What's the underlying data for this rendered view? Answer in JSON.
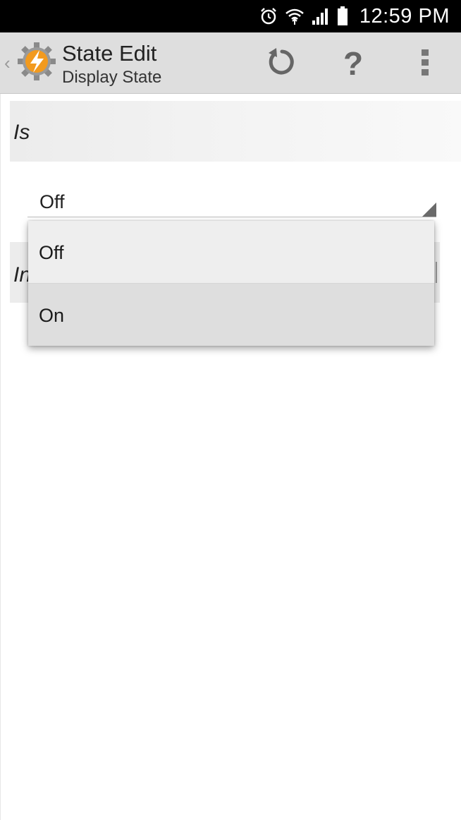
{
  "status_bar": {
    "time": "12:59 PM",
    "icons": [
      "alarm-icon",
      "wifi-icon",
      "signal-icon",
      "battery-icon"
    ]
  },
  "action_bar": {
    "title": "State Edit",
    "subtitle": "Display State",
    "actions": [
      "undo-icon",
      "help-icon",
      "overflow-menu-icon"
    ],
    "help_glyph": "?",
    "up_glyph": "‹"
  },
  "content": {
    "section_is_label": "Is",
    "spinner_value": "Off",
    "section_in_label": "In"
  },
  "dropdown": {
    "options": [
      "Off",
      "On"
    ],
    "highlighted": "On"
  },
  "colors": {
    "status_bar": "#000000",
    "action_bar": "#dedede",
    "app_icon_orange": "#f29a1e",
    "app_icon_gear": "#8a8a8a",
    "icon_gray": "#666666"
  }
}
